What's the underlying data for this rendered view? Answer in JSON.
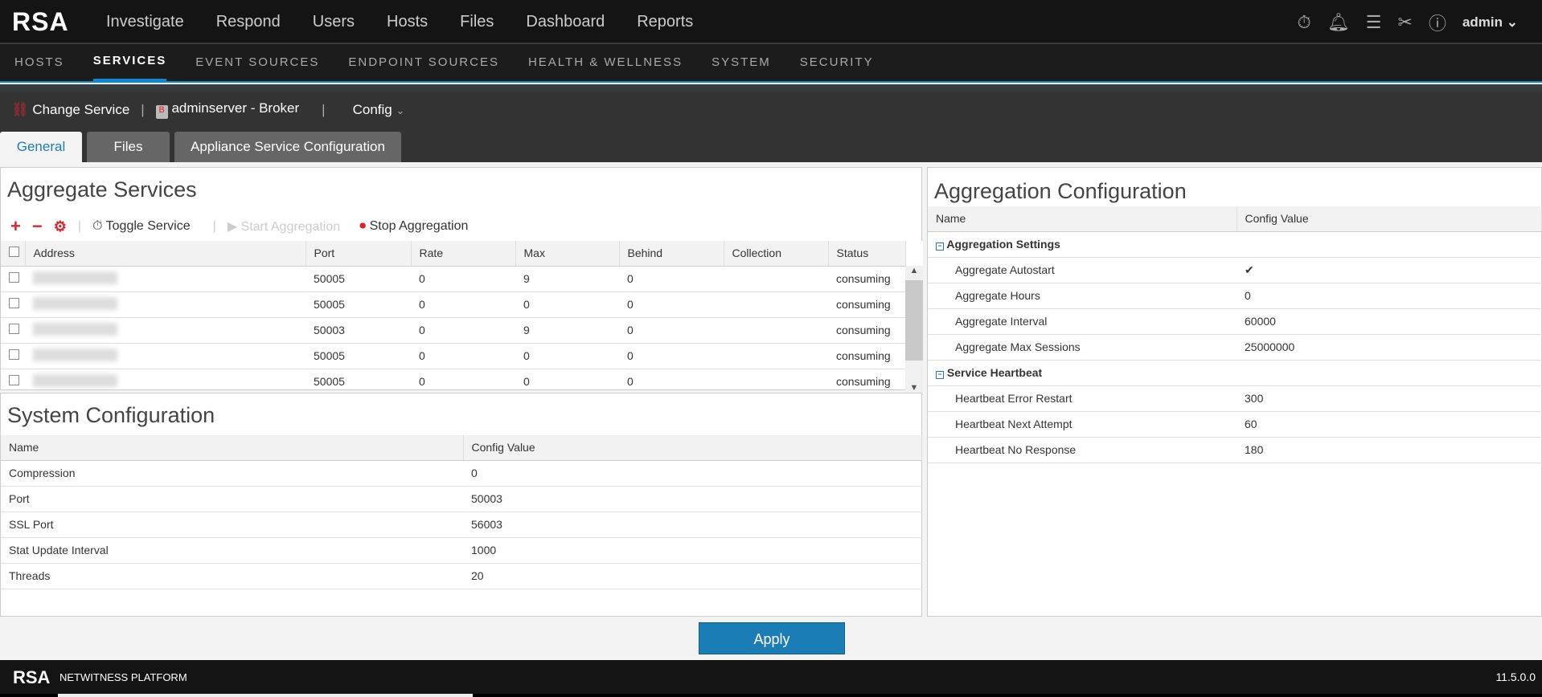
{
  "topbar": {
    "logo": "RSA",
    "nav": [
      "Investigate",
      "Respond",
      "Users",
      "Hosts",
      "Files",
      "Dashboard",
      "Reports"
    ],
    "user": "admin"
  },
  "subnav": [
    "HOSTS",
    "SERVICES",
    "EVENT SOURCES",
    "ENDPOINT SOURCES",
    "HEALTH & WELLNESS",
    "SYSTEM",
    "SECURITY"
  ],
  "service_bar": {
    "change": "Change Service",
    "service": "adminserver - Broker",
    "view": "Config"
  },
  "tabs": [
    "General",
    "Files",
    "Appliance Service Configuration"
  ],
  "aggregate": {
    "title": "Aggregate Services",
    "toggle": "Toggle Service",
    "start": "Start Aggregation",
    "stop": "Stop Aggregation",
    "columns": [
      "Address",
      "Port",
      "Rate",
      "Max",
      "Behind",
      "Collection",
      "Status"
    ],
    "rows": [
      [
        "",
        "50005",
        "0",
        "9",
        "0",
        "",
        "consuming"
      ],
      [
        "",
        "50005",
        "0",
        "0",
        "0",
        "",
        "consuming"
      ],
      [
        "",
        "50003",
        "0",
        "9",
        "0",
        "",
        "consuming"
      ],
      [
        "",
        "50005",
        "0",
        "0",
        "0",
        "",
        "consuming"
      ],
      [
        "",
        "50005",
        "0",
        "0",
        "0",
        "",
        "consuming"
      ]
    ]
  },
  "system": {
    "title": "System Configuration",
    "columns": [
      "Name",
      "Config Value"
    ],
    "rows": [
      [
        "Compression",
        "0"
      ],
      [
        "Port",
        "50003"
      ],
      [
        "SSL Port",
        "56003"
      ],
      [
        "Stat Update Interval",
        "1000"
      ],
      [
        "Threads",
        "20"
      ]
    ]
  },
  "aggconf": {
    "title": "Aggregation Configuration",
    "columns": [
      "Name",
      "Config Value"
    ],
    "groups": [
      {
        "name": "Aggregation Settings",
        "rows": [
          [
            "Aggregate Autostart",
            "✔"
          ],
          [
            "Aggregate Hours",
            "0"
          ],
          [
            "Aggregate Interval",
            "60000"
          ],
          [
            "Aggregate Max Sessions",
            "25000000"
          ]
        ]
      },
      {
        "name": "Service Heartbeat",
        "rows": [
          [
            "Heartbeat Error Restart",
            "300"
          ],
          [
            "Heartbeat Next Attempt",
            "60"
          ],
          [
            "Heartbeat No Response",
            "180"
          ]
        ]
      }
    ]
  },
  "apply": "Apply",
  "footer": {
    "brand": "NETWITNESS PLATFORM",
    "version": "11.5.0.0"
  }
}
